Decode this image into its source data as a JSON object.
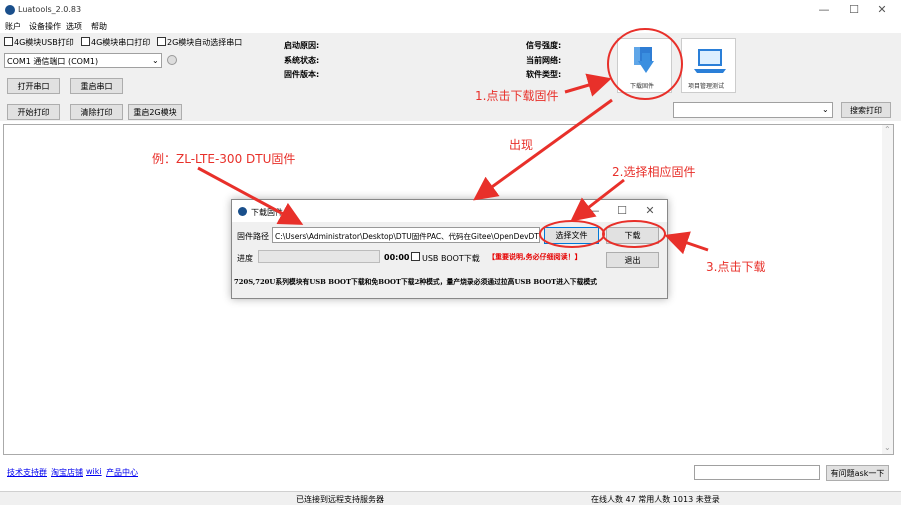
{
  "app": {
    "title": "Luatools_2.0.83",
    "menu": [
      "账户",
      "设备操作",
      "选项",
      "帮助"
    ]
  },
  "toolbar": {
    "checks": [
      "4G模块USB打印",
      "4G模块串口打印",
      "2G模块自动选择串口"
    ],
    "com_select": "COM1 通信端口 (COM1)",
    "open_port": "打开串口",
    "restart_port": "重启串口",
    "start_print": "开始打印",
    "clear_print": "清除打印",
    "restart_2g": "重启2G模块",
    "search_print": "搜索打印"
  },
  "info": {
    "left": [
      "启动原因:",
      "系统状态:",
      "固件版本:"
    ],
    "right": [
      "信号强度:",
      "当前网络:",
      "软件类型:"
    ]
  },
  "tiles": {
    "download": "下载固件",
    "project": "项目管理测试"
  },
  "dialog": {
    "title": "下载固件",
    "path_label": "固件路径",
    "path_value": "C:\\Users\\Administrator\\Desktop\\DTU固件PAC、代码在Gitee\\OpenDevDT",
    "choose_file": "选择文件",
    "download": "下载",
    "progress_label": "进度",
    "time": "00:00",
    "usb_boot": "USB BOOT下载",
    "important": "【重要说明,务必仔细阅读！】",
    "exit": "退出",
    "note": "720S,720U系列模块有USB BOOT下载和免BOOT下载2种模式，量产烧录必须通过拉高USB BOOT进入下载模式"
  },
  "annotations": {
    "step1": "1.点击下载固件",
    "appear": "出现",
    "example": "例：ZL-LTE-300 DTU固件",
    "step2": "2.选择相应固件",
    "step3": "3.点击下载"
  },
  "footer": {
    "links": [
      "技术支持群",
      "淘宝店铺",
      "wiki",
      "产品中心"
    ],
    "ask_button": "有问题ask一下",
    "status_center": "已连接到远程支持服务器",
    "status_right": "在线人数 47 常用人数 1013 未登录"
  },
  "colors": {
    "annotation": "#e8302a",
    "accent": "#0078d7"
  }
}
